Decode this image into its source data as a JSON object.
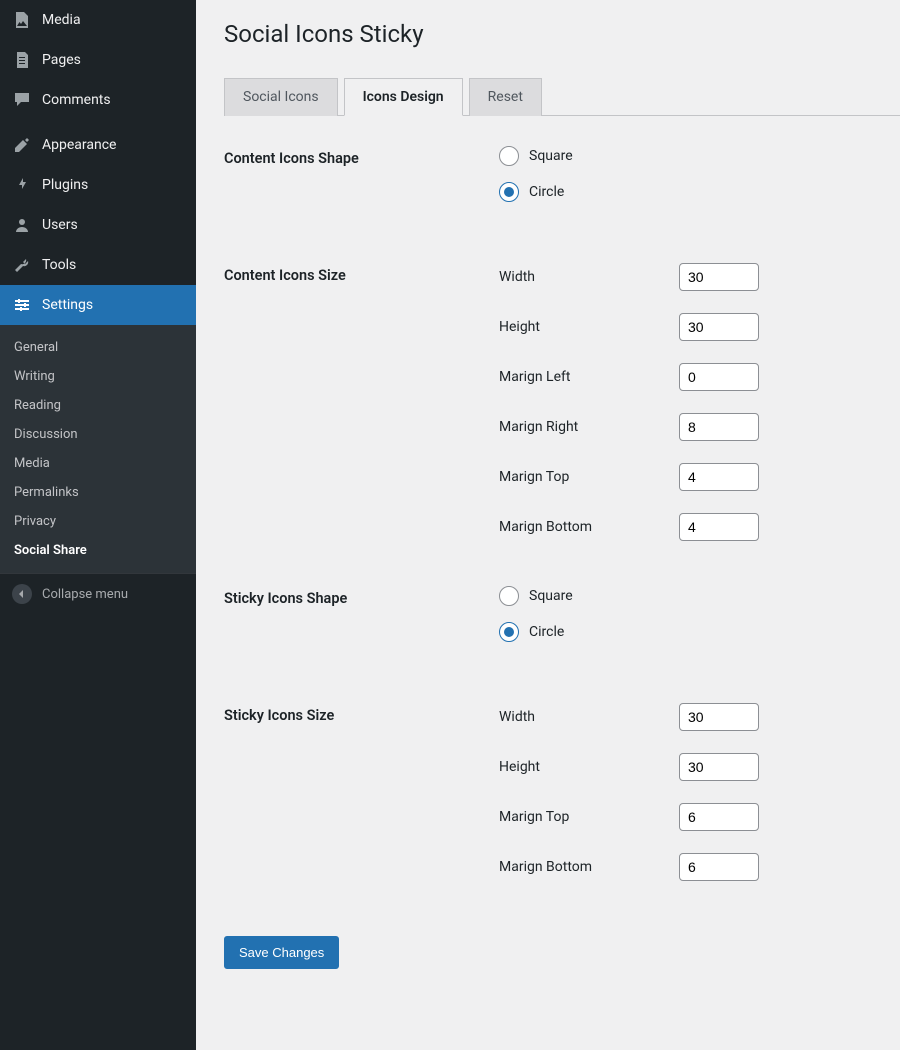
{
  "sidebar": {
    "items": [
      {
        "label": "Media"
      },
      {
        "label": "Pages"
      },
      {
        "label": "Comments"
      },
      {
        "label": "Appearance"
      },
      {
        "label": "Plugins"
      },
      {
        "label": "Users"
      },
      {
        "label": "Tools"
      },
      {
        "label": "Settings"
      }
    ],
    "submenu": [
      {
        "label": "General"
      },
      {
        "label": "Writing"
      },
      {
        "label": "Reading"
      },
      {
        "label": "Discussion"
      },
      {
        "label": "Media"
      },
      {
        "label": "Permalinks"
      },
      {
        "label": "Privacy"
      },
      {
        "label": "Social Share"
      }
    ],
    "collapse": "Collapse menu"
  },
  "page": {
    "title": "Social Icons Sticky",
    "tabs": [
      "Social Icons",
      "Icons Design",
      "Reset"
    ],
    "sections": {
      "content_shape": {
        "label": "Content Icons Shape",
        "options": [
          "Square",
          "Circle"
        ],
        "selected": "Circle"
      },
      "content_size": {
        "label": "Content Icons Size",
        "fields": [
          {
            "label": "Width",
            "value": "30"
          },
          {
            "label": "Height",
            "value": "30"
          },
          {
            "label": "Marign Left",
            "value": "0"
          },
          {
            "label": "Marign Right",
            "value": "8"
          },
          {
            "label": "Marign Top",
            "value": "4"
          },
          {
            "label": "Marign Bottom",
            "value": "4"
          }
        ]
      },
      "sticky_shape": {
        "label": "Sticky Icons Shape",
        "options": [
          "Square",
          "Circle"
        ],
        "selected": "Circle"
      },
      "sticky_size": {
        "label": "Sticky Icons Size",
        "fields": [
          {
            "label": "Width",
            "value": "30"
          },
          {
            "label": "Height",
            "value": "30"
          },
          {
            "label": "Marign Top",
            "value": "6"
          },
          {
            "label": "Marign Bottom",
            "value": "6"
          }
        ]
      }
    },
    "save": "Save Changes"
  }
}
